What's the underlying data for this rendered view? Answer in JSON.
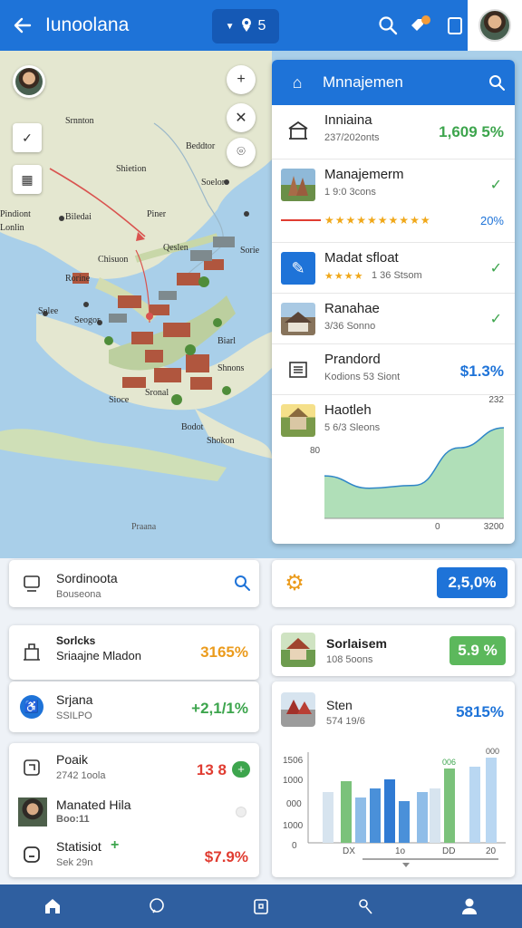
{
  "header": {
    "title": "Iunoolana",
    "chip_count": "5",
    "colors": {
      "primary": "#1e73d8",
      "accent_green": "#3da54d",
      "accent_red": "#e03c31"
    }
  },
  "map": {
    "labels": [
      "Srnnton",
      "Beddtor",
      "Shietion",
      "Soelor",
      "Pindiont",
      "Piner",
      "Biledai",
      "Lonlin",
      "Qeslen",
      "Chisuon",
      "Sorie",
      "Rorine",
      "Solee",
      "Seogor",
      "Biarl",
      "Shnons",
      "Sronal",
      "Sioce",
      "Bodot",
      "Shokon",
      "Praana"
    ]
  },
  "panel": {
    "title": "Mnnajemen",
    "rows": [
      {
        "name": "Inniaina",
        "sub": "237/202onts",
        "value": "1,609 5%"
      },
      {
        "name": "Manajemerm",
        "sub": "1 9:0 3cons",
        "value": "20%"
      },
      {
        "name": "Madat sfloat",
        "sub": "1 36 Stsom",
        "value": ""
      },
      {
        "name": "Ranahae",
        "sub": "3/36 Sonno",
        "value": ""
      },
      {
        "name": "Prandord",
        "sub": "Kodions 53 Siont",
        "value": "$1.3%"
      },
      {
        "name": "Haotleh",
        "sub": "5 6/3 Sleons",
        "value": ""
      }
    ],
    "chart": {
      "y_top": "232",
      "y_mid": "80",
      "x_left": "0",
      "x_right": "3200"
    }
  },
  "chart_data": {
    "type": "area",
    "x": [
      0,
      800,
      1600,
      2400,
      3200
    ],
    "values": [
      95,
      60,
      68,
      175,
      232
    ],
    "title": "",
    "xlabel": "",
    "ylabel": ""
  },
  "search_card": {
    "title": "Sordinoota",
    "sub": "Bouseona"
  },
  "settings_card": {
    "value": "2,5,0%"
  },
  "left_cards": [
    {
      "label_top": "Sorlcks",
      "title": "Sriaajne Mladon",
      "value": "3165%"
    },
    {
      "title": "Srjana",
      "sub": "SSILPO",
      "value": "+2,1/1%"
    }
  ],
  "stats_card": {
    "rows": [
      {
        "title": "Poaik",
        "sub": "2742 1oola",
        "value": "13 8",
        "badge": "+"
      },
      {
        "title": "Manated Hila",
        "sub": "Boo:11",
        "value": ""
      },
      {
        "title": "Statisiot",
        "sub": "Sek 29n",
        "value": "$7.9%"
      }
    ]
  },
  "right_cards": [
    {
      "title": "Sorlaisem",
      "sub": "108 5oons",
      "value": "5.9 %"
    },
    {
      "title": "Sten",
      "sub": "574 19/6",
      "value": "5815%"
    }
  ],
  "bar_chart_labels": {
    "y": [
      "1506",
      "1000",
      "000",
      "1000",
      "0"
    ],
    "x": [
      "DX",
      "1o",
      "DD",
      "20"
    ],
    "top_left": "006",
    "top_right": "000"
  },
  "nav": [
    "home",
    "chat",
    "box",
    "people",
    "profile"
  ]
}
